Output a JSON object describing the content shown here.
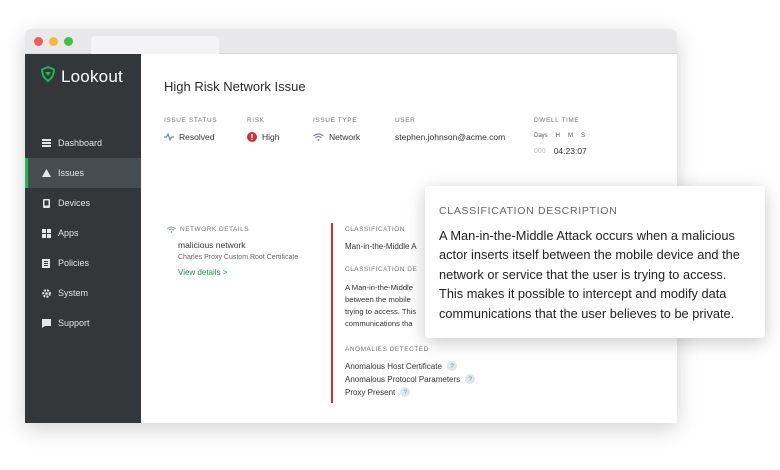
{
  "brand": {
    "name": "Lookout",
    "color": "#1db954"
  },
  "sidebar": {
    "items": [
      {
        "label": "Dashboard",
        "icon": "list-icon"
      },
      {
        "label": "Issues",
        "icon": "warning-icon",
        "active": true
      },
      {
        "label": "Devices",
        "icon": "phone-icon"
      },
      {
        "label": "Apps",
        "icon": "grid-icon"
      },
      {
        "label": "Policies",
        "icon": "document-icon"
      },
      {
        "label": "System",
        "icon": "gear-icon"
      },
      {
        "label": "Support",
        "icon": "chat-icon"
      }
    ]
  },
  "page": {
    "title": "High Risk Network Issue"
  },
  "meta": {
    "issue_status": {
      "label": "Issue Status",
      "value": "Resolved",
      "icon": "pulse-icon"
    },
    "risk": {
      "label": "Risk",
      "value": "High",
      "icon": "alert-circle-icon",
      "color": "#d0313a"
    },
    "issue_type": {
      "label": "Issue Type",
      "value": "Network",
      "icon": "wifi-icon"
    },
    "user": {
      "label": "User",
      "value": "stephen.johnson@acme.com"
    },
    "dwell_time": {
      "label": "Dwell Time",
      "days_label": "Days",
      "h_label": "H",
      "m_label": "M",
      "s_label": "S",
      "days_value": "000",
      "hms_value": "04:23:07"
    }
  },
  "network_details": {
    "label": "NETWORK DETAILS",
    "network": "malicious network",
    "certificate": "Charles Proxy Custom Root Certificate",
    "link": "View details >"
  },
  "classification": {
    "label": "Classification",
    "value": "Man-in-the-Middle A",
    "desc_label": "Classification De",
    "desc_lines": [
      "A Man-in-the-Middle",
      "between the mobile",
      "trying to access. This",
      "communications tha"
    ]
  },
  "anomalies": {
    "label": "Anomalies Detected",
    "items": [
      "Anomalous Host Certificate",
      "Anomalous Protocol Parameters",
      "Proxy Present"
    ],
    "help": "?"
  },
  "popover": {
    "title": "Classification Description",
    "lines": [
      "A Man-in-the-Middle Attack occurs when a malicious",
      "actor inserts itself between the mobile device and the",
      "network or service that the user is  trying to access.",
      "This makes it possible to intercept and modify data",
      "communications that the user believes to be private."
    ]
  }
}
